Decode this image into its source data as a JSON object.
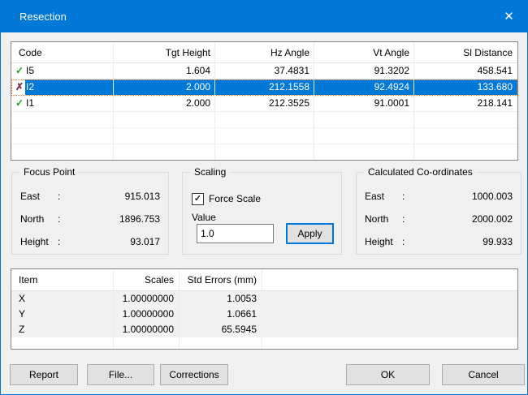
{
  "window": {
    "title": "Resection"
  },
  "icons": {
    "close": "✕",
    "accepted": "✓",
    "rejected": "✗",
    "checkbox_check": "✓"
  },
  "punctuation": {
    "colon": ":"
  },
  "observations_table": {
    "columns": [
      "Code",
      "Tgt Height",
      "Hz Angle",
      "Vt Angle",
      "Sl Distance"
    ],
    "rows": [
      {
        "status": "accepted",
        "code": "I5",
        "tgt_height": "1.604",
        "hz_angle": "37.4831",
        "vt_angle": "91.3202",
        "sl_distance": "458.541",
        "selected": false
      },
      {
        "status": "rejected",
        "code": "I2",
        "tgt_height": "2.000",
        "hz_angle": "212.1558",
        "vt_angle": "92.4924",
        "sl_distance": "133.680",
        "selected": true
      },
      {
        "status": "accepted",
        "code": "I1",
        "tgt_height": "2.000",
        "hz_angle": "212.3525",
        "vt_angle": "91.0001",
        "sl_distance": "218.141",
        "selected": false
      }
    ],
    "empty_row_count": 3
  },
  "focus_point": {
    "title": "Focus Point",
    "rows": [
      {
        "label": "East",
        "value": "915.013"
      },
      {
        "label": "North",
        "value": "1896.753"
      },
      {
        "label": "Height",
        "value": "93.017"
      }
    ]
  },
  "scaling": {
    "title": "Scaling",
    "force_scale_label": "Force Scale",
    "force_scale_checked": true,
    "value_label": "Value",
    "value": "1.0",
    "apply_label": "Apply"
  },
  "calculated_coordinates": {
    "title": "Calculated Co-ordinates",
    "rows": [
      {
        "label": "East",
        "value": "1000.003"
      },
      {
        "label": "North",
        "value": "2000.002"
      },
      {
        "label": "Height",
        "value": "99.933"
      }
    ]
  },
  "results_table": {
    "columns": [
      "Item",
      "Scales",
      "Std Errors (mm)"
    ],
    "rows": [
      {
        "item": "X",
        "scale": "1.00000000",
        "std_error": "1.0053"
      },
      {
        "item": "Y",
        "scale": "1.00000000",
        "std_error": "1.0661"
      },
      {
        "item": "Z",
        "scale": "1.00000000",
        "std_error": "65.5945"
      }
    ]
  },
  "buttons": {
    "report": "Report",
    "file": "File...",
    "corrections": "Corrections",
    "ok": "OK",
    "cancel": "Cancel"
  },
  "colors": {
    "titlebar": "#0078D7",
    "selection": "#0078D7",
    "focus_rect": "#ED7D31",
    "accepted_green": "#1F9B1F",
    "rejected_maroon": "#7B2D43",
    "dialog_background": "#F0F0F0"
  }
}
